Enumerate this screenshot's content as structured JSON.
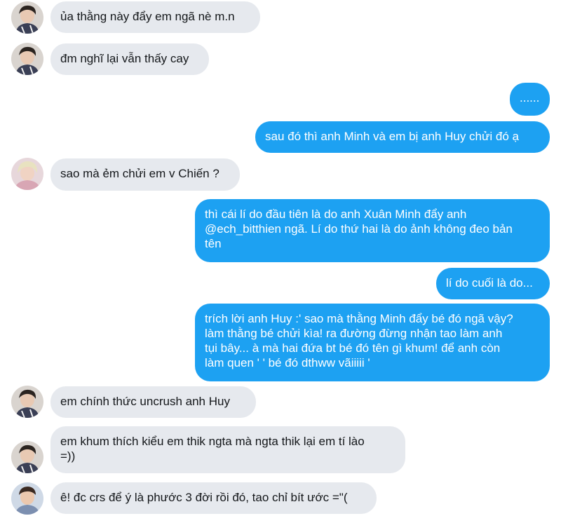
{
  "messages": [
    {
      "id": "m1",
      "side": "in",
      "text": "ủa thằng này đẩy em ngã nè m.n"
    },
    {
      "id": "m2",
      "side": "in",
      "text": "đm nghĩ lại vẫn thấy cay"
    },
    {
      "id": "m3",
      "side": "out",
      "text": "......"
    },
    {
      "id": "m4",
      "side": "out",
      "text": "sau đó thì anh Minh và em bị anh Huy chửi đó ạ"
    },
    {
      "id": "m5",
      "side": "in",
      "text": "sao mà ẻm chửi em v Chiến ?"
    },
    {
      "id": "m6",
      "side": "out",
      "text": "thì cái lí do đầu tiên là do anh Xuân Minh đẩy anh\n@ech_bitthien ngã. Lí do thứ hai là do ảnh không đeo bản\ntên"
    },
    {
      "id": "m7",
      "side": "out",
      "text": "lí do cuối là do..."
    },
    {
      "id": "m8",
      "side": "out",
      "text": "trích lời anh Huy :' sao mà thằng Minh đẩy bé đó ngã vậy?\nlàm thằng bé chửi kìa! ra đường đừng nhận tao làm anh\ntụi bây... à mà hai đứa bt bé đó tên gì khum! để anh còn\nlàm quen ' ' bé đó dthww vãiiiii '"
    },
    {
      "id": "m9",
      "side": "in",
      "text": "em chính thức uncrush anh Huy"
    },
    {
      "id": "m10",
      "side": "in",
      "text": "em khum thích kiểu em thik ngta mà ngta thik lại em tí lào\n=))"
    },
    {
      "id": "m11",
      "side": "in",
      "text": "ê! đc crs để ý là phước 3 đời rồi đó, tao chỉ bít ước =\"("
    }
  ],
  "avatars": [
    {
      "id": "a1",
      "name": "dark-hair-avatar"
    },
    {
      "id": "a2",
      "name": "dark-hair-avatar"
    },
    {
      "id": "a3",
      "name": "blonde-hair-avatar"
    },
    {
      "id": "a4",
      "name": "dark-hair-avatar"
    },
    {
      "id": "a5",
      "name": "dark-hair-avatar"
    },
    {
      "id": "a6",
      "name": "boy-avatar"
    }
  ],
  "colors": {
    "incoming_bubble": "#e6e9ee",
    "outgoing_bubble": "#1da1f2",
    "incoming_text": "#14171a",
    "outgoing_text": "#ffffff"
  }
}
